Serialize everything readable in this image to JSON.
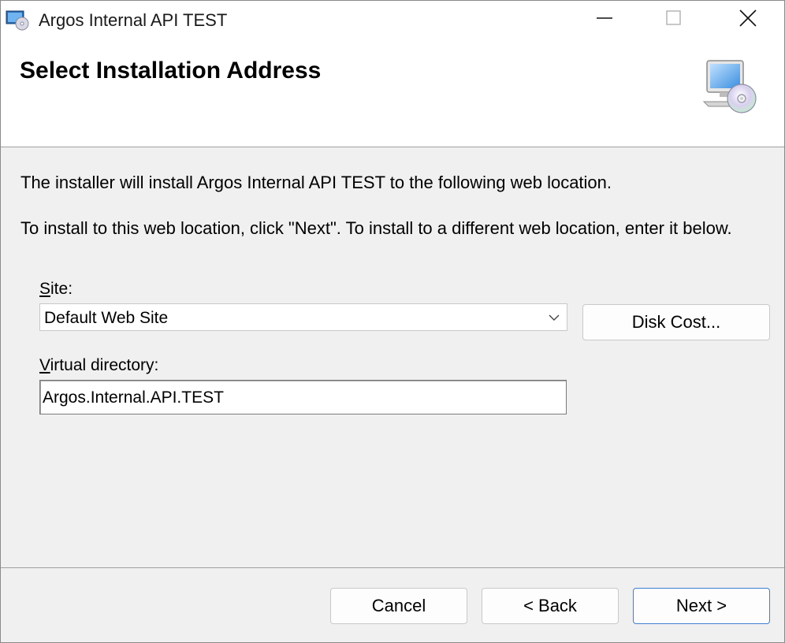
{
  "window": {
    "title": "Argos Internal API TEST",
    "icon": "installer-cd-icon",
    "controls": {
      "minimize": "minimize-icon",
      "maximize": "maximize-icon",
      "close": "close-icon"
    }
  },
  "header": {
    "title": "Select Installation Address",
    "icon": "computer-cd-icon"
  },
  "body": {
    "description1": "The installer will install Argos Internal API TEST to the following web location.",
    "description2": "To install to this web location, click \"Next\". To install to a different web location, enter it below.",
    "site_label_mnemonic": "S",
    "site_label_rest": "ite:",
    "site_value": "Default Web Site",
    "disk_cost_label": "Disk Cost...",
    "vdir_label_mnemonic": "V",
    "vdir_label_rest": "irtual directory:",
    "vdir_value": "Argos.Internal.API.TEST"
  },
  "footer": {
    "cancel_label": "Cancel",
    "back_label": "< Back",
    "next_label": "Next >"
  },
  "colors": {
    "dialog_bg": "#f0f0f0",
    "header_bg": "#ffffff",
    "default_button_border": "#3f7fd1"
  }
}
